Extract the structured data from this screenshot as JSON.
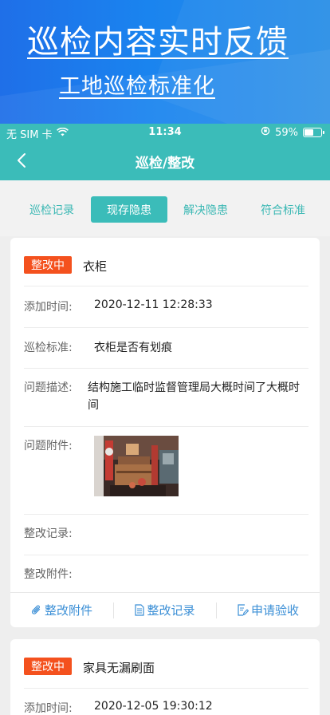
{
  "banner": {
    "title": "巡检内容实时反馈",
    "subtitle": "工地巡检标准化"
  },
  "status_bar": {
    "carrier": "无 SIM 卡",
    "time": "11:34",
    "battery": "59%",
    "battery_level": 0.59
  },
  "navbar": {
    "title": "巡检/整改"
  },
  "tabs": [
    {
      "label": "巡检记录",
      "active": false
    },
    {
      "label": "现存隐患",
      "active": true
    },
    {
      "label": "解决隐患",
      "active": false
    },
    {
      "label": "符合标准",
      "active": false
    }
  ],
  "labels": {
    "add_time": "添加时间:",
    "standard": "巡检标准:",
    "description": "问题描述:",
    "attachment": "问题附件:",
    "rectify_record": "整改记录:",
    "rectify_attachment": "整改附件:"
  },
  "actions": {
    "attachment": "整改附件",
    "record": "整改记录",
    "apply": "申请验收"
  },
  "cards": [
    {
      "status": "整改中",
      "title": "衣柜",
      "add_time": "2020-12-11 12:28:33",
      "standard": "衣柜是否有划痕",
      "description": "结构施工临时监督管理局大概时间了大概时间",
      "rectify_record": "",
      "rectify_attachment": ""
    },
    {
      "status": "整改中",
      "title": "家具无漏刷面",
      "add_time": "2020-12-05 19:30:12"
    }
  ],
  "colors": {
    "teal": "#3bbcb9",
    "badge": "#f4511e",
    "action_blue": "#3b8fd6"
  }
}
